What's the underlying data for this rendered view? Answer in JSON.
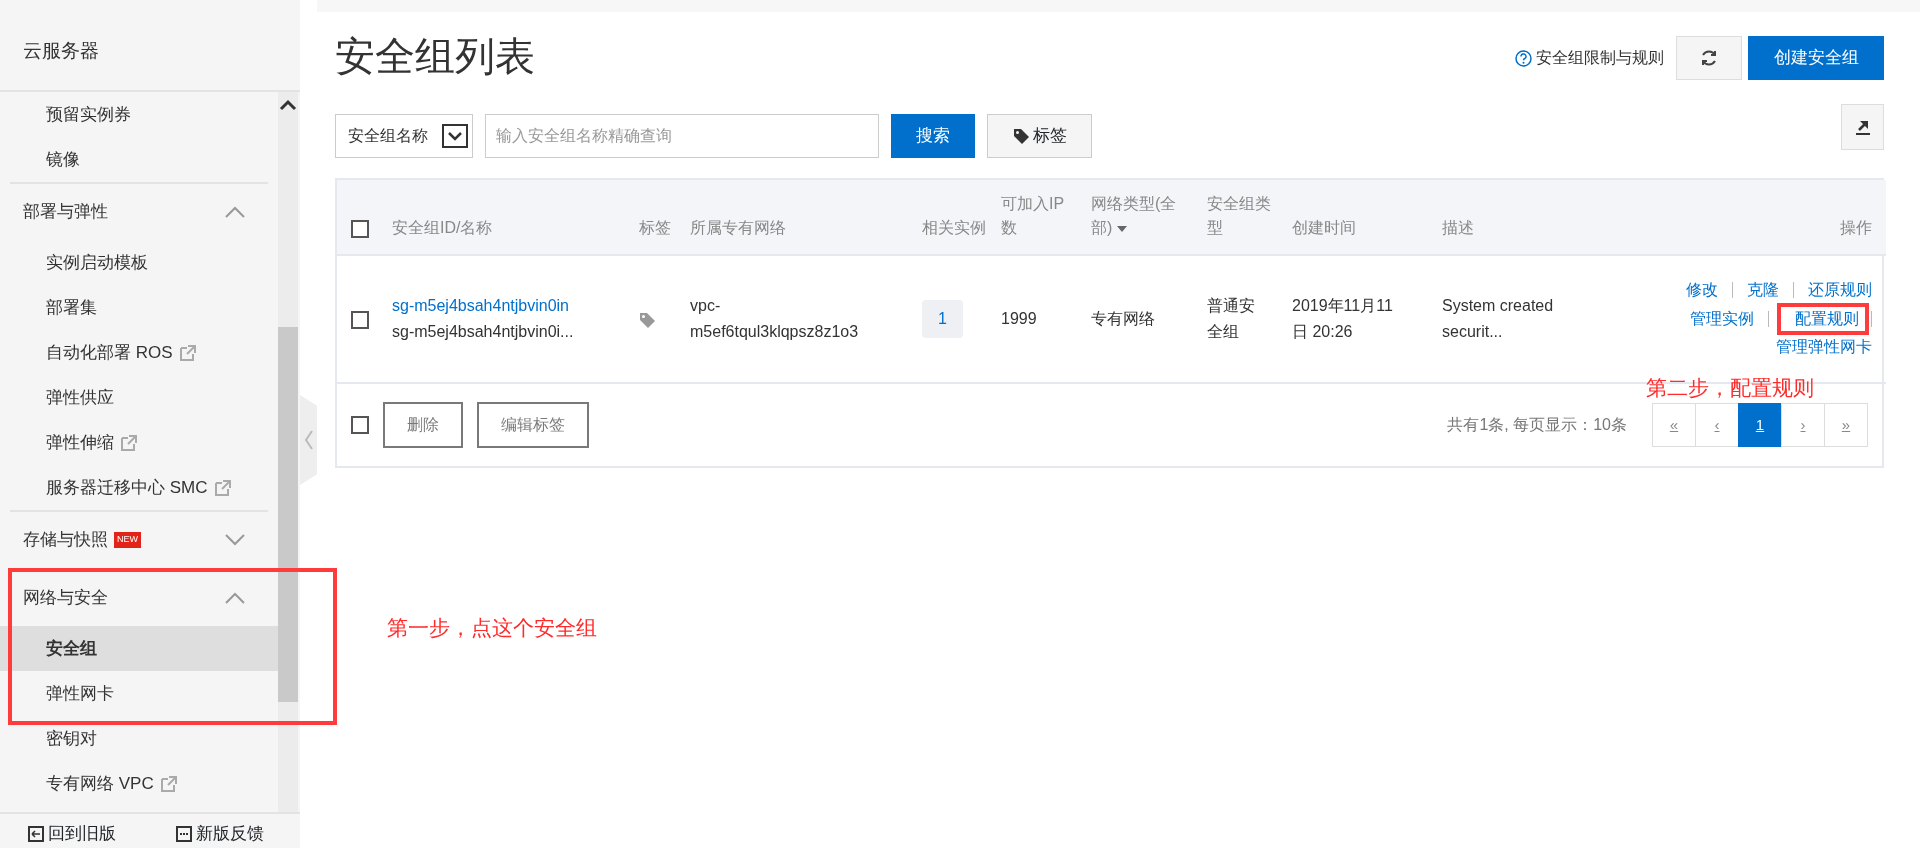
{
  "sidebar": {
    "title": "云服务器",
    "items": [
      {
        "label": "预留实例券",
        "selected": false
      },
      {
        "label": "镜像",
        "selected": false
      }
    ],
    "groups": [
      {
        "title": "部署与弹性",
        "expanded": true,
        "items": [
          {
            "label": "实例启动模板",
            "selected": false,
            "external": false
          },
          {
            "label": "部署集",
            "selected": false,
            "external": false
          },
          {
            "label": "自动化部署 ROS",
            "selected": false,
            "external": true
          },
          {
            "label": "弹性供应",
            "selected": false,
            "external": false
          },
          {
            "label": "弹性伸缩",
            "selected": false,
            "external": true
          },
          {
            "label": "服务器迁移中心 SMC",
            "selected": false,
            "external": true
          }
        ]
      },
      {
        "title": "存储与快照",
        "badge": "NEW",
        "expanded": false
      },
      {
        "title": "网络与安全",
        "expanded": true,
        "highlighted": true,
        "items": [
          {
            "label": "安全组",
            "selected": true,
            "external": false
          },
          {
            "label": "弹性网卡",
            "selected": false,
            "external": false
          },
          {
            "label": "密钥对",
            "selected": false,
            "external": false
          },
          {
            "label": "专有网络 VPC",
            "selected": false,
            "external": true
          }
        ]
      }
    ],
    "footer_links": [
      "回到旧版",
      "新版反馈"
    ]
  },
  "page": {
    "title": "安全组列表",
    "help_link": "安全组限制与规则",
    "create_button": "创建安全组",
    "search": {
      "field_select": "安全组名称",
      "placeholder": "输入安全组名称精确查询",
      "button": "搜索",
      "tag_button": "标签"
    },
    "table": {
      "select_all": false,
      "columns": [
        {
          "label": "安全组ID/名称",
          "filter": false
        },
        {
          "label": "标签",
          "filter": false
        },
        {
          "label": "所属专有网络",
          "filter": false
        },
        {
          "label": "相关实例",
          "filter": false
        },
        {
          "label": "可加入IP数",
          "filter": false
        },
        {
          "label": "网络类型(全部)",
          "filter": true
        },
        {
          "label": "安全组类型",
          "filter": false
        },
        {
          "label": "创建时间",
          "filter": false
        },
        {
          "label": "描述",
          "filter": false
        },
        {
          "label": "操作",
          "filter": false
        }
      ],
      "rows": [
        {
          "selected": false,
          "id": "sg-m5ej4bsah4ntjbvin0in",
          "name": "sg-m5ej4bsah4ntjbvin0i...",
          "vpc": "vpc-m5ef6tqul3klqpsz8z1o3",
          "instances": "1",
          "ip_count": "1999",
          "network_type": "专有网络",
          "group_type": "普通安全组",
          "created": "2019年11月11日 20:26",
          "description": "System created securit...",
          "actions": [
            [
              {
                "label": "修改",
                "highlighted": false
              },
              {
                "label": "克隆",
                "highlighted": false
              },
              {
                "label": "还原规则",
                "highlighted": false
              }
            ],
            [
              {
                "label": "管理实例",
                "highlighted": false
              },
              {
                "label": "配置规则",
                "highlighted": true
              }
            ],
            [
              {
                "label": "管理弹性网卡",
                "highlighted": false
              }
            ]
          ]
        }
      ],
      "footer": {
        "select_all": false,
        "buttons": [
          {
            "label": "删除",
            "disabled": true
          },
          {
            "label": "编辑标签",
            "disabled": true
          }
        ],
        "total": "共有1条, 每页显示：10条",
        "pages": [
          {
            "label": "«",
            "selected": false
          },
          {
            "label": "‹",
            "selected": false
          },
          {
            "label": "1",
            "selected": true
          },
          {
            "label": "›",
            "selected": false
          },
          {
            "label": "»",
            "selected": false
          }
        ]
      }
    }
  },
  "annotations": [
    "第一步，点这个安全组",
    "第二步，配置规则"
  ]
}
